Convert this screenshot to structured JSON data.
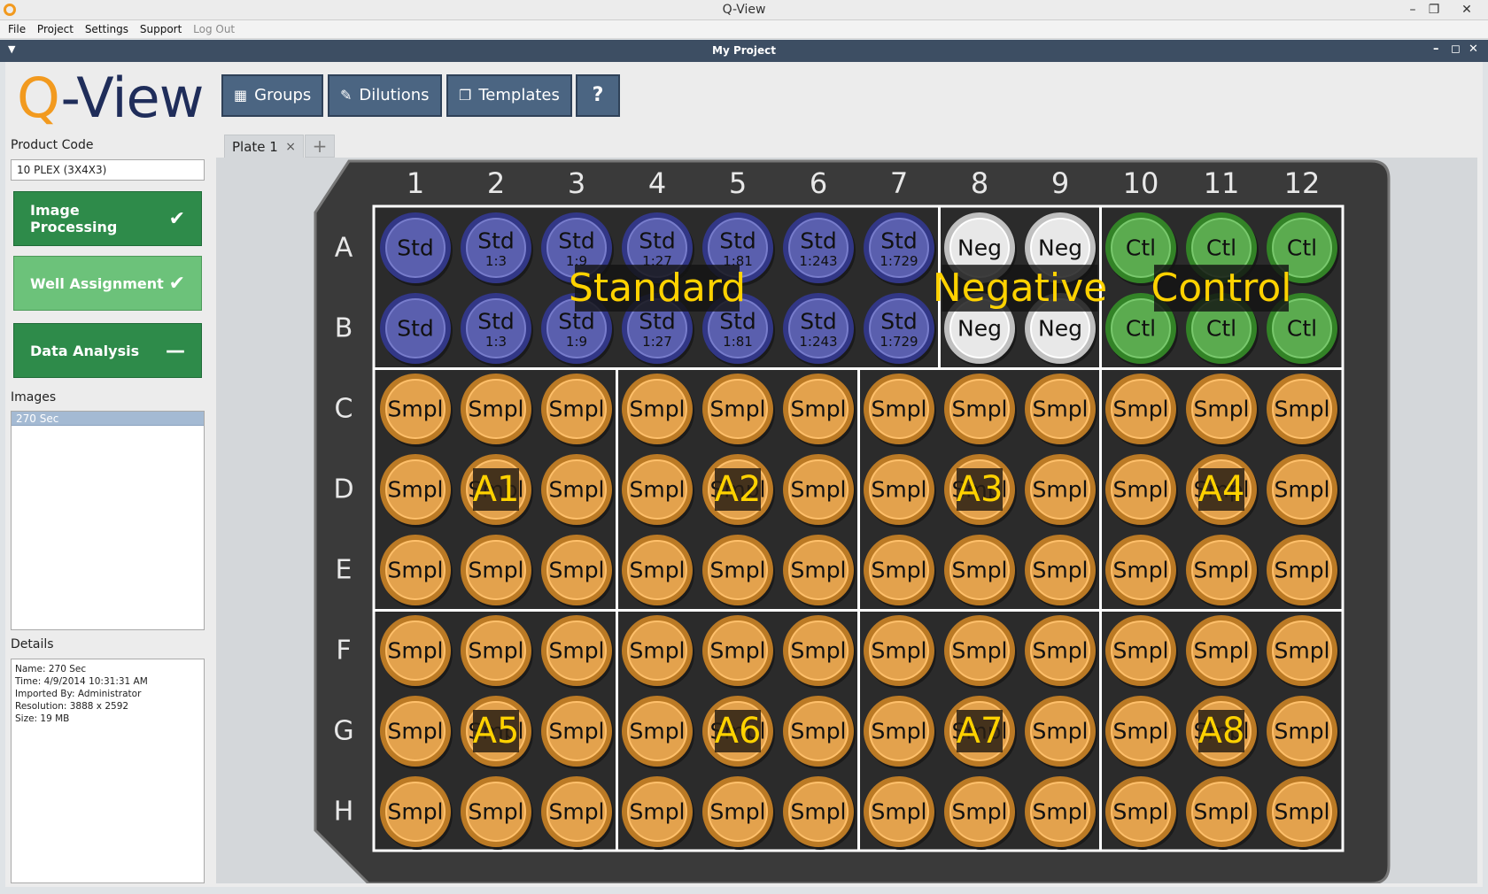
{
  "window": {
    "title": "Q-View"
  },
  "menu": {
    "file": "File",
    "project": "Project",
    "settings": "Settings",
    "support": "Support",
    "logout": "Log Out"
  },
  "project": {
    "title": "My Project"
  },
  "logo": {
    "q": "Q",
    "rest": "-View"
  },
  "toolbar": {
    "groups": "Groups",
    "dilutions": "Dilutions",
    "templates": "Templates",
    "help": "?"
  },
  "sidebar": {
    "product_code_label": "Product Code",
    "product_code_value": "10 PLEX (3X4X3)",
    "steps": [
      {
        "label": "Image Processing",
        "status": "✔"
      },
      {
        "label": "Well Assignment",
        "status": "✔"
      },
      {
        "label": "Data Analysis",
        "status": "—"
      }
    ],
    "images_label": "Images",
    "images": [
      "270 Sec"
    ],
    "details_label": "Details",
    "details": [
      "Name: 270 Sec",
      "Time: 4/9/2014 10:31:31 AM",
      "Imported By: Administrator",
      "Resolution: 3888 x 2592",
      "Size: 19 MB"
    ]
  },
  "tabs": {
    "plate": "Plate 1",
    "close": "×",
    "add": "+"
  },
  "plate": {
    "columns": [
      "1",
      "2",
      "3",
      "4",
      "5",
      "6",
      "7",
      "8",
      "9",
      "10",
      "11",
      "12"
    ],
    "rows": [
      "A",
      "B",
      "C",
      "D",
      "E",
      "F",
      "G",
      "H"
    ],
    "std_dilutions": [
      "",
      "1:3",
      "1:9",
      "1:27",
      "1:81",
      "1:243",
      "1:729"
    ],
    "std_label": "Std",
    "neg_label": "Neg",
    "ctl_label": "Ctl",
    "smpl_label": "Smpl",
    "group_labels": {
      "standard": "Standard",
      "negative": "Negative",
      "control": "Control"
    },
    "sample_groups": [
      "A1",
      "A2",
      "A3",
      "A4",
      "A5",
      "A6",
      "A7",
      "A8"
    ],
    "colors": {
      "std": "#5a5fae",
      "neg": "#e8e8e8",
      "ctl": "#5bab4f",
      "smpl": "#e3a24d",
      "label": "#ffd200"
    }
  },
  "colors": {
    "accent_orange": "#f29a1f",
    "logo_navy": "#1f2d5a",
    "toolbar": "#4b6582",
    "step_green_dark": "#2e8b4a",
    "step_green_light": "#6cc27a"
  }
}
